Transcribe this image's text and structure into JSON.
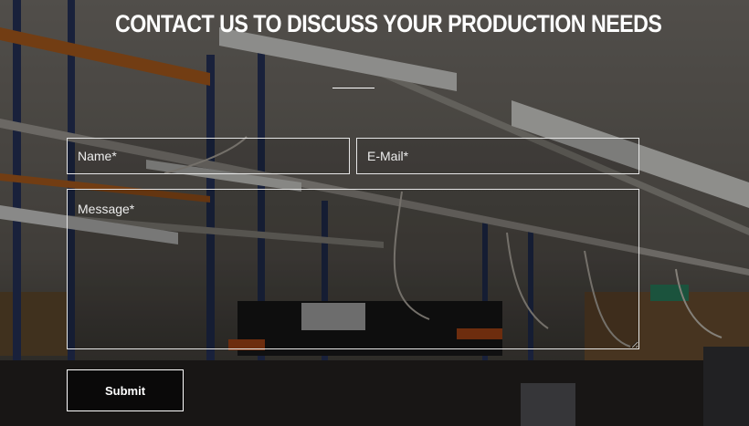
{
  "contact": {
    "heading": "CONTACT US TO DISCUSS YOUR PRODUCTION NEEDS",
    "fields": {
      "name_placeholder": "Name*",
      "email_placeholder": "E-Mail*",
      "message_placeholder": "Message*"
    },
    "submit_label": "Submit"
  },
  "colors": {
    "text": "#ffffff",
    "border": "#e6e6e6",
    "overlay": "rgba(0,0,0,0.42)"
  }
}
